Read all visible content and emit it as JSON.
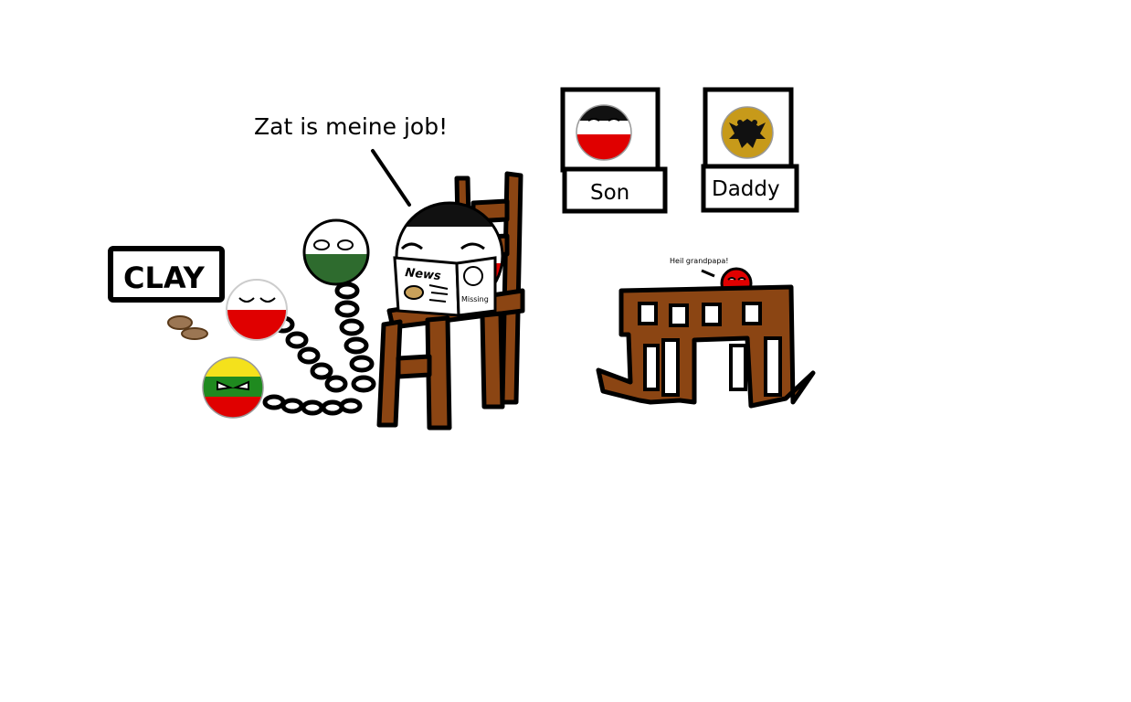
{
  "speech": {
    "main": "Zat is meine job!",
    "small": "Heil grandpapa!"
  },
  "signs": {
    "clay": "CLAY"
  },
  "newspaper": {
    "headline": "News",
    "missing_caption": "Missing"
  },
  "portraits": {
    "son_label": "Son",
    "daddy_label": "Daddy"
  },
  "colors": {
    "wood": "#8B4513",
    "flag_red": "#e00000",
    "flag_green": "#2e6b2e",
    "lithuania_yellow": "#f4e11c",
    "lithuania_green": "#1f8a1f",
    "gold": "#c79a1a"
  },
  "icons": [
    "clay-lumps-icon",
    "chain-icon",
    "eagle-coat-of-arms-icon",
    "potato-icon"
  ]
}
